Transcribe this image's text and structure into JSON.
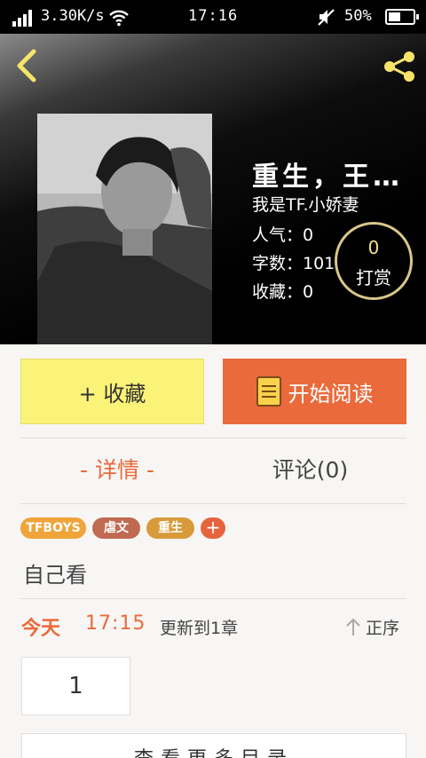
{
  "status_bar": {
    "net_speed": "3.30K/s",
    "time": "17:16",
    "battery": "50%",
    "battery_level": 0.5
  },
  "header": {
    "back_icon": "chevron-left-icon",
    "share_icon": "share-icon"
  },
  "book": {
    "title": "重生，王…",
    "author": "我是TF.小娇妻",
    "popularity": "人气：0",
    "word_count": "字数：101",
    "favorites": "收藏：0"
  },
  "reward": {
    "count": "0",
    "label": "打赏"
  },
  "actions": {
    "favorite_label": "+ 收藏",
    "read_label": "开始阅读"
  },
  "tabs": {
    "detail": "- 详情 -",
    "comments": "评论(0)"
  },
  "tags": [
    {
      "label": "TFBOYS",
      "color": "#f0a43a"
    },
    {
      "label": "虐文",
      "color": "#c06a52"
    },
    {
      "label": "重生",
      "color": "#d89a3a"
    }
  ],
  "tag_add_label": "+",
  "description": "自己看",
  "update": {
    "date": "今天",
    "time": "17:15",
    "text": "更新到1章"
  },
  "sort_label": "正序",
  "chapters": [
    "1"
  ],
  "more_label": "查看更多目录",
  "colors": {
    "accent": "#ea6a3b",
    "favorite_button": "#fbf278",
    "background": "#f7f6f4"
  }
}
